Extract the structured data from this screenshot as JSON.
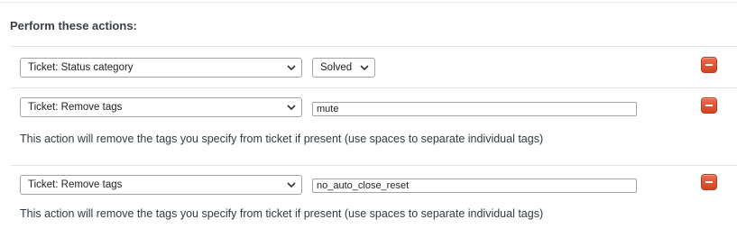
{
  "section": {
    "title": "Perform these actions:"
  },
  "actions": [
    {
      "field": "Ticket: Status category",
      "value_select": "Solved"
    },
    {
      "field": "Ticket: Remove tags",
      "value_input": "mute",
      "help": "This action will remove the tags you specify from ticket if present (use spaces to separate individual tags)"
    },
    {
      "field": "Ticket: Remove tags",
      "value_input": "no_auto_close_reset",
      "help": "This action will remove the tags you specify from ticket if present (use spaces to separate individual tags)"
    }
  ],
  "icons": {
    "select_caret": "chevron-down-icon",
    "remove": "minus-icon"
  },
  "colors": {
    "remove_button": "#e0522f",
    "text": "#2f3941"
  }
}
